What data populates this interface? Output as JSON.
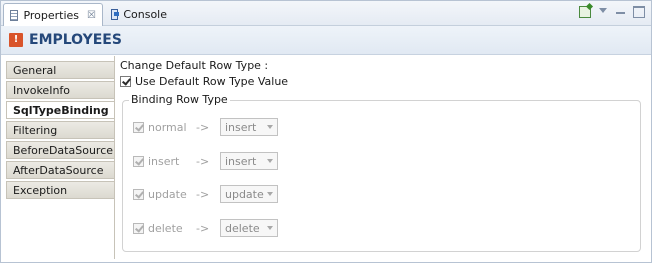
{
  "tabs": [
    {
      "label": "Properties",
      "close": "☒"
    },
    {
      "label": "Console"
    }
  ],
  "title": "EMPLOYEES",
  "side_tabs": [
    "General",
    "InvokeInfo",
    "SqlTypeBinding",
    "Filtering",
    "BeforeDataSource",
    "AfterDataSource",
    "Exception"
  ],
  "selected_side_tab": "SqlTypeBinding",
  "content": {
    "change_label": "Change Default Row Type :",
    "use_default_label": "Use Default Row Type Value",
    "use_default_checked": true,
    "group_title": "Binding Row Type",
    "arrow": "->",
    "rows": [
      {
        "name": "normal",
        "value": "insert",
        "checked": true
      },
      {
        "name": "insert",
        "value": "insert",
        "checked": true
      },
      {
        "name": "update",
        "value": "update",
        "checked": true
      },
      {
        "name": "delete",
        "value": "delete",
        "checked": true
      }
    ]
  }
}
